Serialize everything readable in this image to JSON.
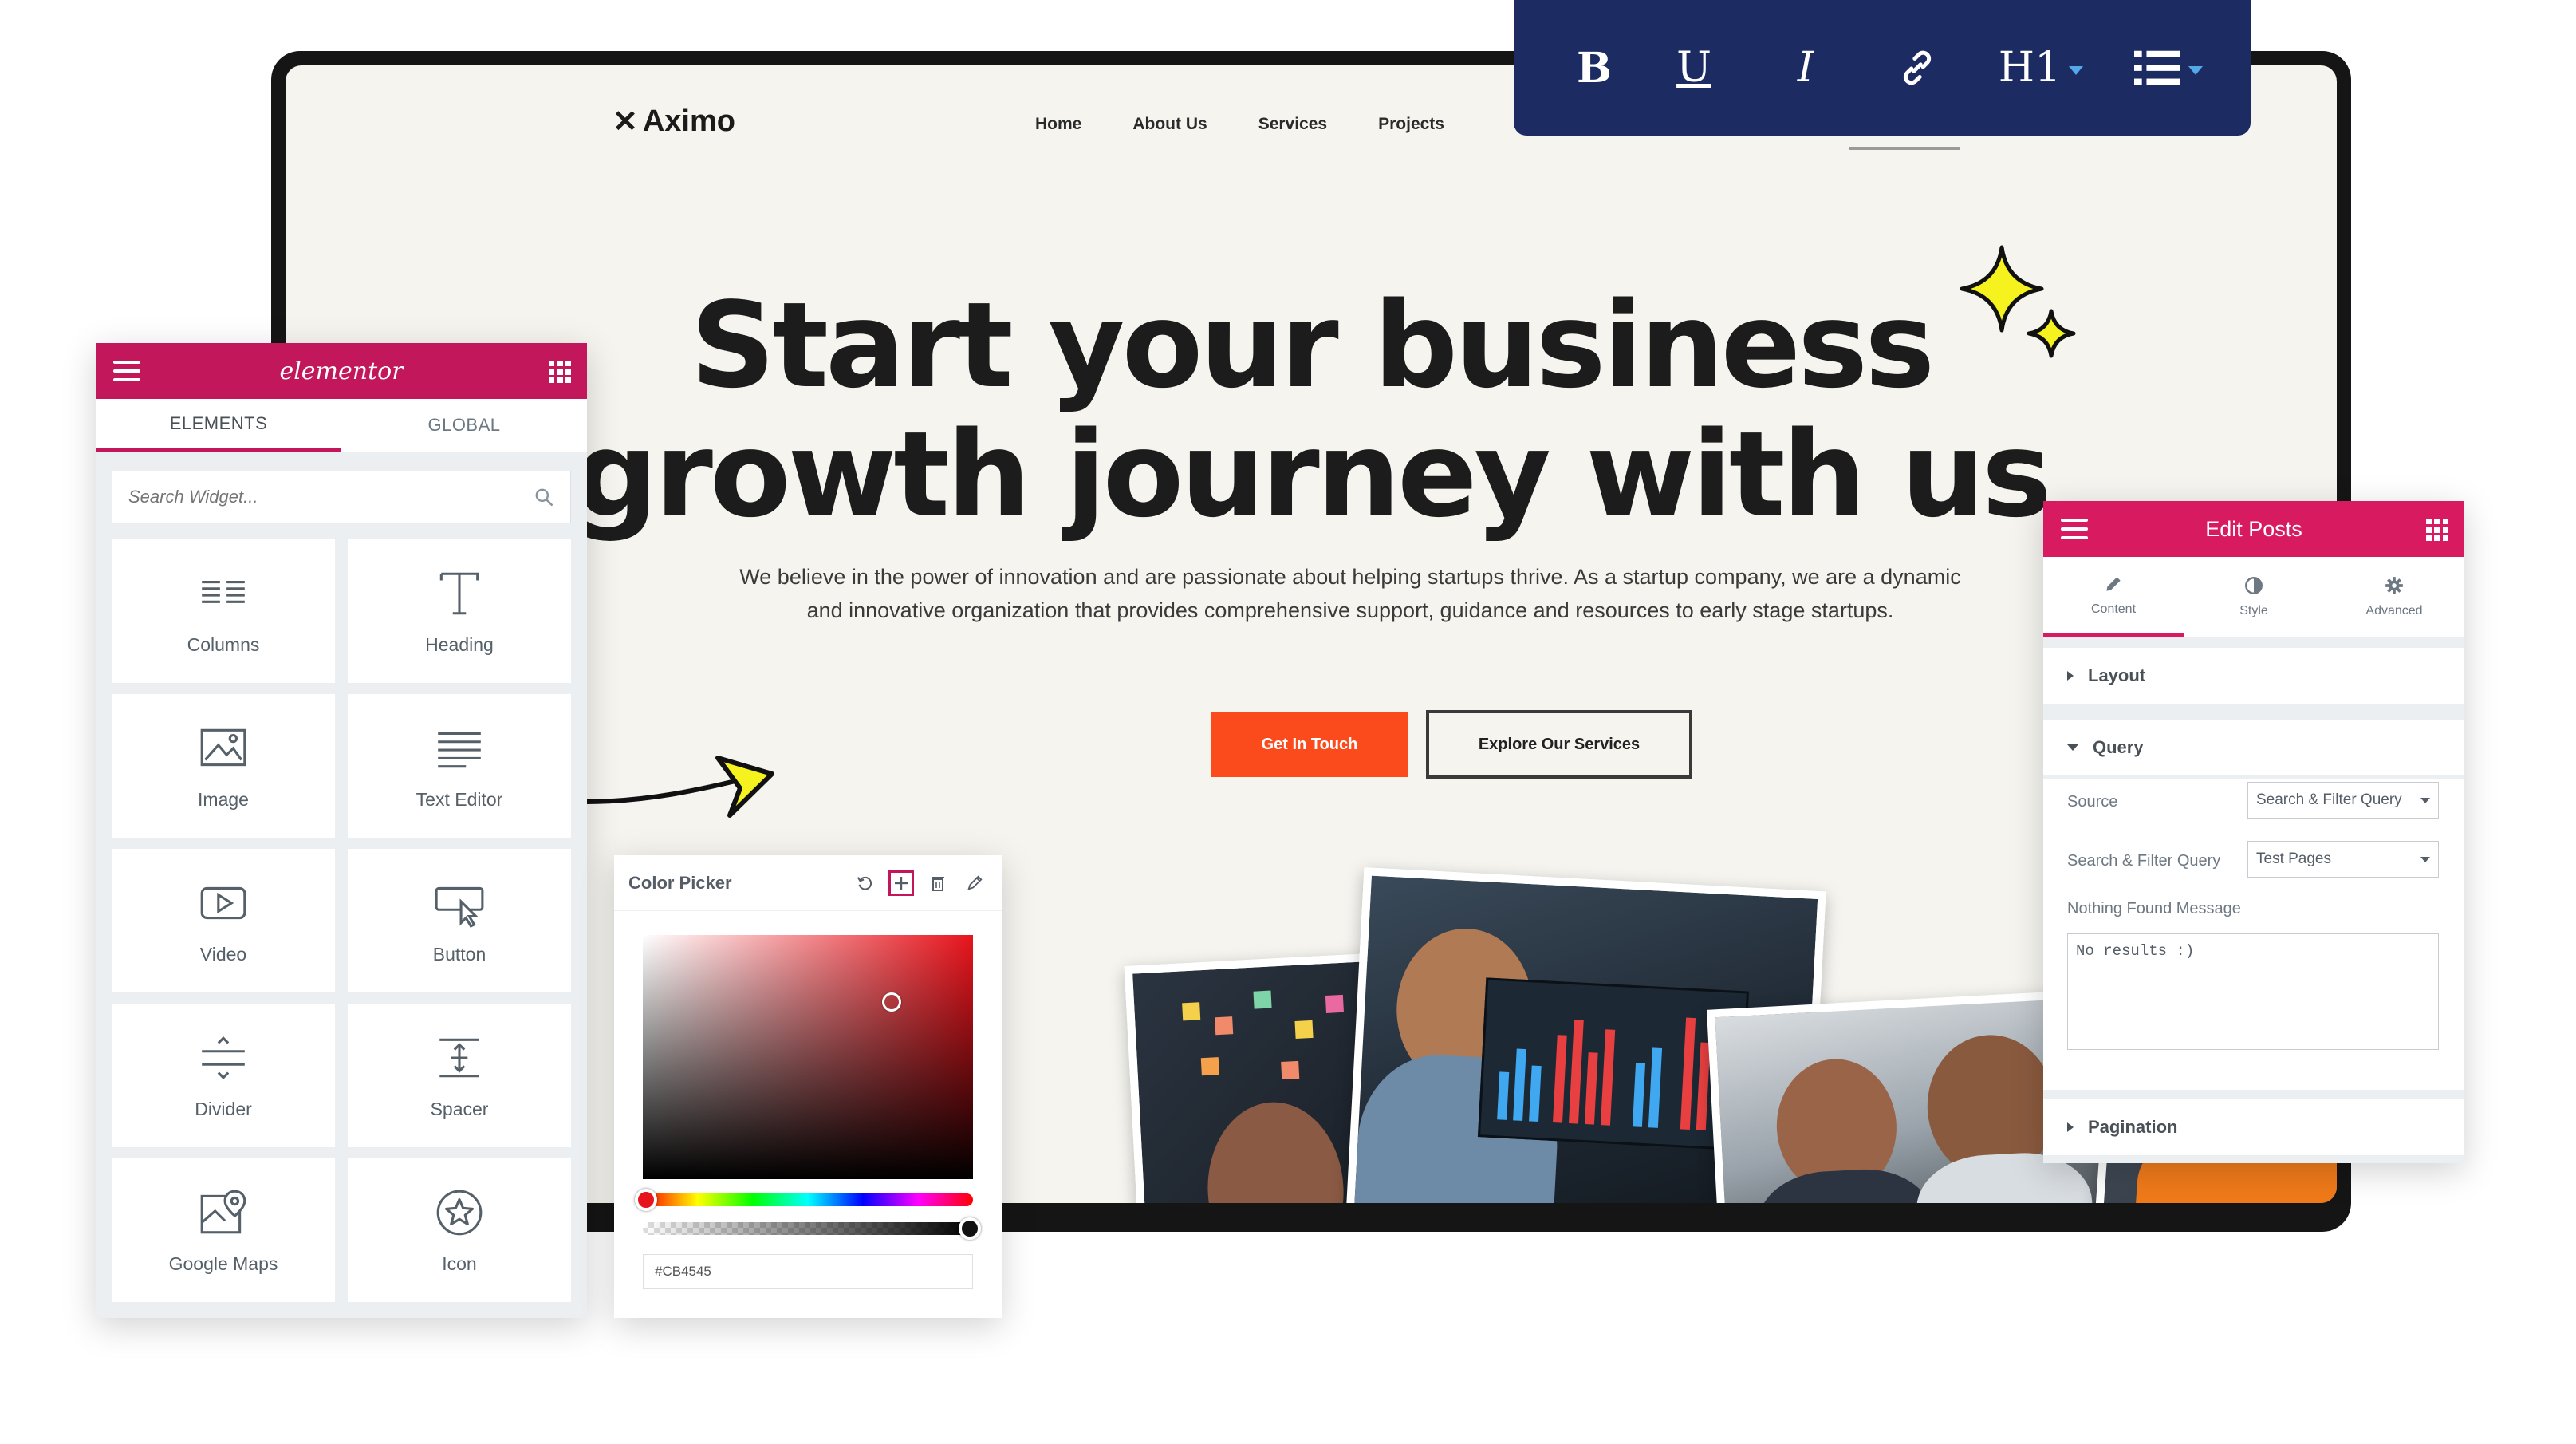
{
  "website": {
    "logo": "Aximo",
    "nav": [
      "Home",
      "About Us",
      "Services",
      "Projects"
    ],
    "hero_line1": "Start your business",
    "hero_line2": "growth journey with us",
    "hero_sub_1": "We believe in the power of innovation and are passionate about helping startups thrive. As a startup company, we are a dynamic",
    "hero_sub_2": "and innovative organization that provides comprehensive support, guidance and resources to early stage startups.",
    "btn_primary": "Get In Touch",
    "btn_secondary": "Explore Our Services"
  },
  "elements_panel": {
    "brand": "elementor",
    "tabs": [
      "ELEMENTS",
      "GLOBAL"
    ],
    "search_placeholder": "Search Widget...",
    "widgets": [
      {
        "label": "Columns",
        "icon": "columns-icon"
      },
      {
        "label": "Heading",
        "icon": "heading-icon"
      },
      {
        "label": "Image",
        "icon": "image-icon"
      },
      {
        "label": "Text Editor",
        "icon": "text-editor-icon"
      },
      {
        "label": "Video",
        "icon": "video-icon"
      },
      {
        "label": "Button",
        "icon": "button-icon"
      },
      {
        "label": "Divider",
        "icon": "divider-icon"
      },
      {
        "label": "Spacer",
        "icon": "spacer-icon"
      },
      {
        "label": "Google Maps",
        "icon": "google-maps-icon"
      },
      {
        "label": "Icon",
        "icon": "star-icon"
      }
    ]
  },
  "color_picker": {
    "title": "Color Picker",
    "hex_value": "#CB4545"
  },
  "edit_posts": {
    "title": "Edit Posts",
    "tabs": [
      "Content",
      "Style",
      "Advanced"
    ],
    "section_layout": "Layout",
    "section_query": "Query",
    "source_label": "Source",
    "source_value": "Search & Filter Query",
    "sf_query_label": "Search & Filter Query",
    "sf_query_value": "Test Pages",
    "nothing_found_label": "Nothing Found Message",
    "nothing_found_value": "No results :)",
    "section_pagination": "Pagination"
  },
  "toolbar": {
    "bold": "B",
    "underline": "U",
    "italic": "I",
    "heading": "H1"
  },
  "colors": {
    "elementor_brand": "#c2185b",
    "edit_posts_brand": "#d81b60",
    "cta_orange": "#fb4a1c",
    "toolbar_navy": "#1d2b63",
    "sparkle_yellow": "#f6f21e"
  }
}
